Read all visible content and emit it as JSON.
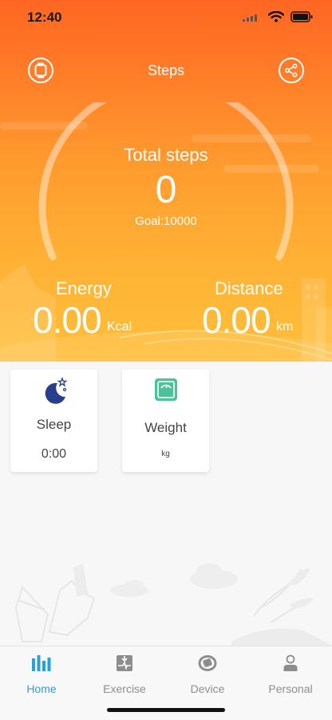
{
  "status_bar": {
    "time": "12:40"
  },
  "header": {
    "title": "Steps"
  },
  "steps": {
    "label": "Total steps",
    "value": "0",
    "goal": "Goal:10000",
    "progress": 0
  },
  "energy": {
    "label": "Energy",
    "value": "0.00",
    "unit": "Kcal"
  },
  "distance": {
    "label": "Distance",
    "value": "0.00",
    "unit": "km"
  },
  "cards": {
    "sleep": {
      "label": "Sleep",
      "value": "0:00",
      "icon": "moon-stars-icon"
    },
    "weight": {
      "label": "Weight",
      "value": "kg",
      "icon": "scale-icon"
    }
  },
  "tabs": [
    {
      "label": "Home",
      "icon": "bar-chart-icon",
      "active": true
    },
    {
      "label": "Exercise",
      "icon": "exercise-icon",
      "active": false
    },
    {
      "label": "Device",
      "icon": "band-icon",
      "active": false
    },
    {
      "label": "Personal",
      "icon": "person-icon",
      "active": false
    }
  ],
  "colors": {
    "accent": "#27a0dd",
    "header_top": "#ff6622",
    "header_bottom": "#ffbf3a",
    "sleep_icon": "#2a3e8e",
    "weight_icon": "#4cc29a"
  }
}
